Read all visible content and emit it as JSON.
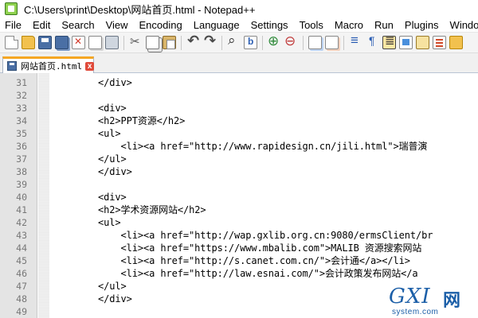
{
  "window": {
    "title": "C:\\Users\\print\\Desktop\\网站首页.html - Notepad++"
  },
  "menu": [
    "File",
    "Edit",
    "Search",
    "View",
    "Encoding",
    "Language",
    "Settings",
    "Tools",
    "Macro",
    "Run",
    "Plugins",
    "Window"
  ],
  "toolbar": {
    "icons": [
      "new-file-icon",
      "open-file-icon",
      "save-icon",
      "save-all-icon",
      "close-icon",
      "close-all-icon",
      "print-icon",
      "cut-icon",
      "copy-icon",
      "paste-icon",
      "undo-icon",
      "redo-icon",
      "find-icon",
      "replace-icon",
      "zoom-in-icon",
      "zoom-out-icon",
      "sync-vertical-icon",
      "sync-horizontal-icon",
      "word-wrap-icon",
      "show-all-characters-icon",
      "indent-guide-icon",
      "user-defined-language-icon",
      "document-map-icon",
      "function-list-icon",
      "folder-workspace-icon"
    ]
  },
  "tab": {
    "label": "网站首页.html",
    "close_glyph": "x"
  },
  "editor": {
    "lines": [
      {
        "num": "31",
        "text": "        </div>"
      },
      {
        "num": "32",
        "text": ""
      },
      {
        "num": "33",
        "text": "        <div>"
      },
      {
        "num": "34",
        "text": "        <h2>PPT资源</h2>"
      },
      {
        "num": "35",
        "text": "        <ul>"
      },
      {
        "num": "36",
        "text": "            <li><a href=\"http://www.rapidesign.cn/jili.html\">瑞普演"
      },
      {
        "num": "37",
        "text": "        </ul>"
      },
      {
        "num": "38",
        "text": "        </div>"
      },
      {
        "num": "39",
        "text": ""
      },
      {
        "num": "40",
        "text": "        <div>"
      },
      {
        "num": "41",
        "text": "        <h2>学术资源网站</h2>"
      },
      {
        "num": "42",
        "text": "        <ul>"
      },
      {
        "num": "43",
        "text": "            <li><a href=\"http://wap.gxlib.org.cn:9080/ermsClient/br"
      },
      {
        "num": "44",
        "text": "            <li><a href=\"https://www.mbalib.com\">MALIB 资源搜索网站"
      },
      {
        "num": "45",
        "text": "            <li><a href=\"http://s.canet.com.cn/\">会计通</a></li>"
      },
      {
        "num": "46",
        "text": "            <li><a href=\"http://law.esnai.com/\">会计政策发布网站</a"
      },
      {
        "num": "47",
        "text": "        </ul>"
      },
      {
        "num": "48",
        "text": "        </div>"
      },
      {
        "num": "49",
        "text": ""
      }
    ]
  },
  "watermark": {
    "main": "GXI",
    "cn": "网",
    "sub": "system.com"
  }
}
